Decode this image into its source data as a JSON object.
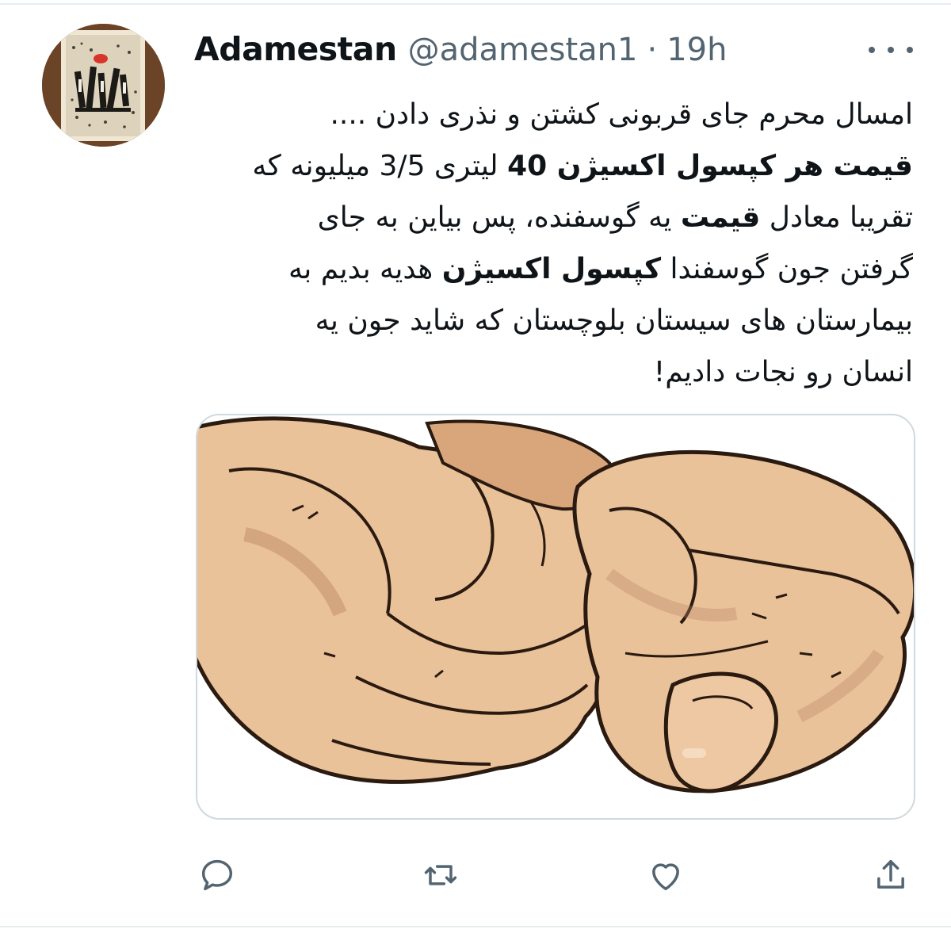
{
  "tweet": {
    "author": {
      "display_name": "Adamestan",
      "handle": "@adamestan1",
      "separator": "·",
      "time": "19h"
    },
    "text_lines": [
      {
        "parts": [
          {
            "t": "امسال محرم جای قربونی کشتن و نذری دادن ....",
            "b": false
          }
        ]
      },
      {
        "parts": [
          {
            "t": "قیمت هر کپسول اکسیژن 40",
            "b": true
          },
          {
            "t": " لیتری  3/5 میلیونه که",
            "b": false
          }
        ]
      },
      {
        "parts": [
          {
            "t": "تقریبا معادل ",
            "b": false
          },
          {
            "t": "قیمت",
            "b": true
          },
          {
            "t": " یه گوسفنده، پس بیاین به جای",
            "b": false
          }
        ]
      },
      {
        "parts": [
          {
            "t": "گرفتن جون گوسفندا ",
            "b": false
          },
          {
            "t": "کپسول اکسیژن",
            "b": true
          },
          {
            "t": " هدیه بدیم به",
            "b": false
          }
        ]
      },
      {
        "parts": [
          {
            "t": "بیمارستان های سیستان بلوچستان که شاید جون یه",
            "b": false
          }
        ]
      },
      {
        "parts": [
          {
            "t": "انسان رو نجات دادیم!",
            "b": false
          }
        ]
      }
    ],
    "media": {
      "description_icon": "fist-bump-illustration"
    },
    "actions": [
      {
        "icon": "reply-icon"
      },
      {
        "icon": "retweet-icon"
      },
      {
        "icon": "like-icon"
      },
      {
        "icon": "share-icon"
      }
    ]
  },
  "colors": {
    "text": "#0f1419",
    "secondary": "#536471",
    "border": "#cfd9de",
    "skin": "#e9c29a",
    "skin_shadow": "#b98561",
    "outline": "#2a1a10"
  }
}
